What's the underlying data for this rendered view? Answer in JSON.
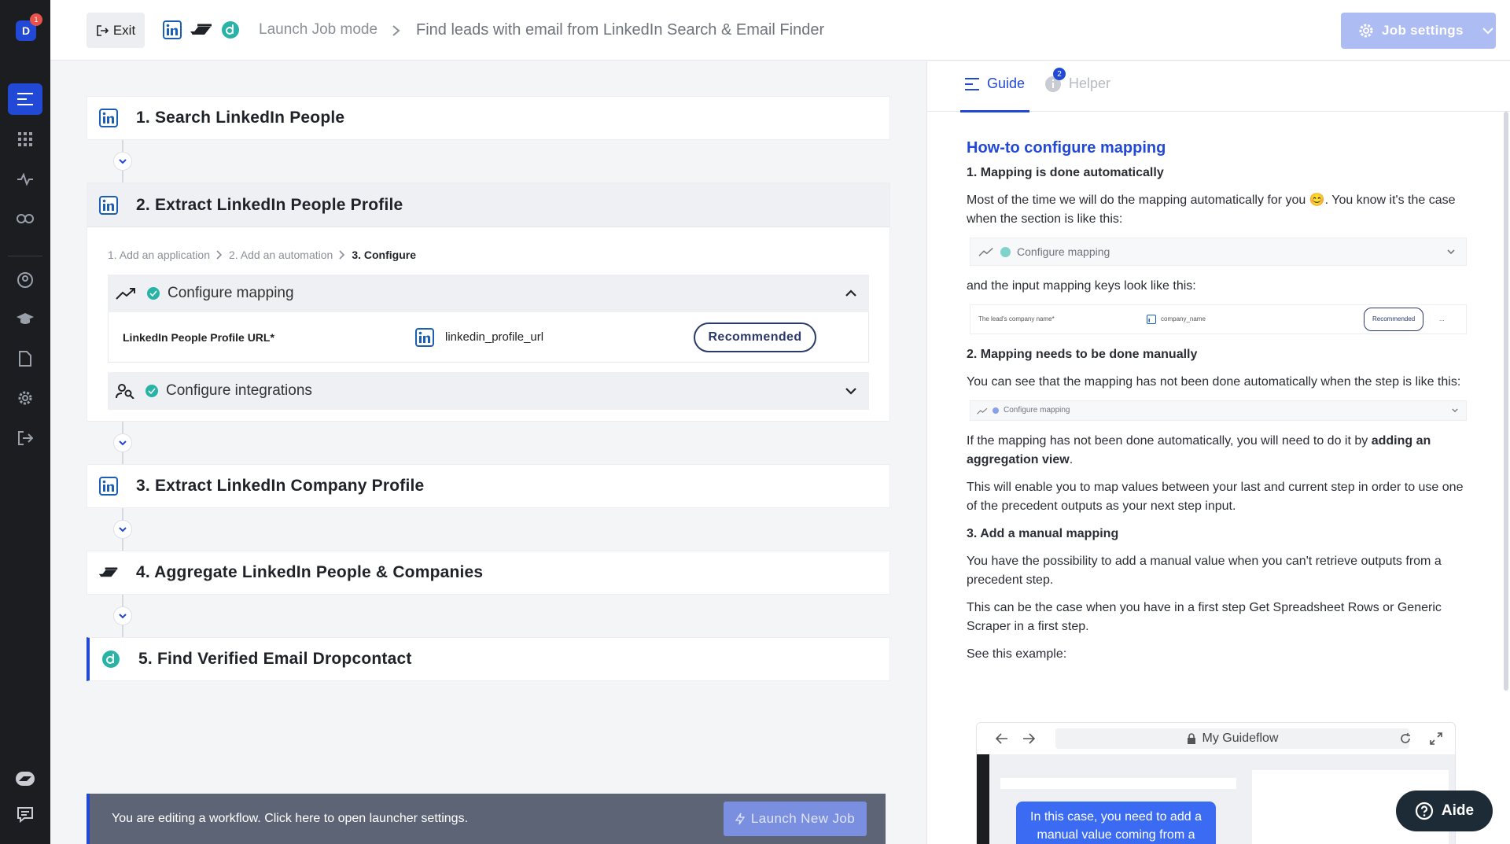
{
  "rail": {
    "avatar_letter": "D",
    "notification_count": "1",
    "items": [
      "guide-menu",
      "apps-grid",
      "activity",
      "link",
      "profile",
      "learn",
      "document",
      "settings",
      "logout",
      "phantom-logo",
      "chat"
    ]
  },
  "topbar": {
    "exit_label": "Exit",
    "crumb_mode": "Launch Job mode",
    "crumb_sep": ">",
    "crumb_title": "Find leads with email from LinkedIn Search & Email Finder",
    "job_settings_label": "Job settings"
  },
  "steps": {
    "s1": "1. Search LinkedIn People",
    "s2": "2. Extract LinkedIn People Profile",
    "s3": "3. Extract LinkedIn Company Profile",
    "s4": "4. Aggregate LinkedIn People & Companies",
    "s5": "5. Find Verified Email Dropcontact"
  },
  "step2": {
    "crumbs": [
      "1. Add an application",
      "2. Add an automation",
      "3. Configure"
    ],
    "configure_mapping": "Configure mapping",
    "field_label": "LinkedIn People Profile URL*",
    "field_value": "linkedin_profile_url",
    "recommended": "Recommended",
    "configure_integrations": "Configure integrations"
  },
  "launcher": {
    "text": "You are editing a workflow. Click here to open launcher settings.",
    "button": "Launch New Job"
  },
  "guide": {
    "tab_guide": "Guide",
    "tab_helper": "Helper",
    "helper_badge": "2",
    "heading": "How-to configure mapping",
    "s1_title": "1. Mapping is done automatically",
    "s1_p1": "Most of the time we will do the mapping automatically for you 😊. You know it's the case when the section is like this:",
    "mock1": "Configure mapping",
    "s1_p2": "and the input mapping keys look like this:",
    "mock2_field": "The lead's company name*",
    "mock2_value": "company_name",
    "mock2_badge": "Recommended",
    "mock2_more": "...",
    "s2_title": "2. Mapping needs to be done manually",
    "s2_p1": "You can see that the mapping has not been done automatically when the step is like this:",
    "mock3": "Configure mapping",
    "s2_p2_a": "If the mapping has not been done automatically, you will need to do it by ",
    "s2_p2_b": "adding an aggregation view",
    "s2_p2_c": ".",
    "s2_p3": "This will enable you to map values between your last and current step in order to use one of the precedent outputs as your next step input.",
    "s3_title": "3. Add a manual mapping",
    "s3_p1": "You have the possibility to add a manual value when you can't retrieve outputs from a precedent step.",
    "s3_p2": "This can be the case when you have in a first step Get Spreadsheet Rows or Generic Scraper in a first step.",
    "s3_p3": "See this example:",
    "browser_title": "My Guideflow",
    "tooltip": "In this case, you need to add a manual value coming from a"
  },
  "aide_label": "Aide",
  "colors": {
    "accent": "#2248d6",
    "check": "#27b3a5",
    "rail": "#1b1d21"
  }
}
